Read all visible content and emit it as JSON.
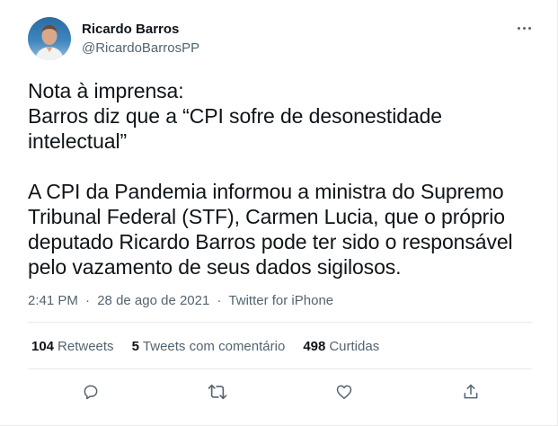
{
  "author": {
    "display_name": "Ricardo Barros",
    "handle": "@RicardoBarrosPP"
  },
  "tweet": {
    "lines_block1": [
      "Nota à imprensa:",
      "Barros diz que a “CPI sofre de desonestidade",
      "intelectual”"
    ],
    "lines_block2": [
      "A CPI da Pandemia informou a ministra do Supremo",
      "Tribunal Federal (STF), Carmen Lucia, que o próprio",
      "deputado Ricardo Barros pode ter sido o responsável",
      "pelo vazamento de seus dados sigilosos."
    ]
  },
  "meta": {
    "time": "2:41 PM",
    "date": "28 de ago de 2021",
    "source": "Twitter for iPhone",
    "separator": "·"
  },
  "stats": {
    "retweets_count": "104",
    "retweets_label": "Retweets",
    "comments_count": "5",
    "comments_label": "Tweets com comentário",
    "likes_count": "498",
    "likes_label": "Curtidas"
  },
  "icons": {
    "more": "more-options-icon",
    "reply": "reply-icon",
    "retweet": "retweet-icon",
    "like": "like-icon",
    "share": "share-icon"
  },
  "colors": {
    "text": "#0f1419",
    "secondary": "#536471",
    "divider": "#e7e9eb"
  }
}
